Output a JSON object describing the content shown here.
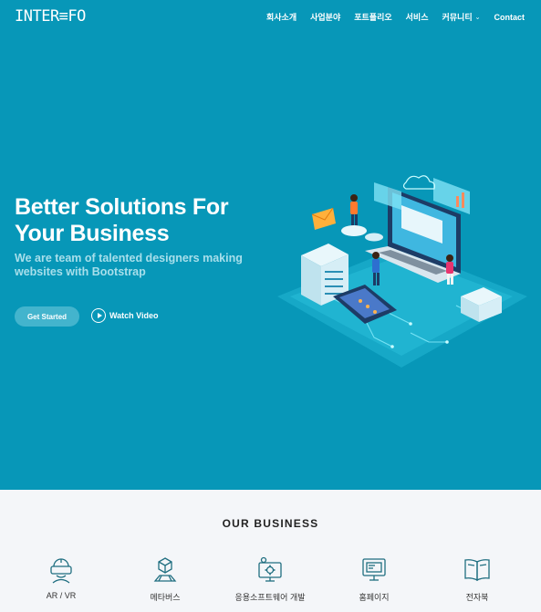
{
  "header": {
    "logo": "INTER≡FO",
    "nav": [
      {
        "label": "회사소개",
        "dropdown": false
      },
      {
        "label": "사업분야",
        "dropdown": false
      },
      {
        "label": "포트폴리오",
        "dropdown": false
      },
      {
        "label": "서비스",
        "dropdown": false
      },
      {
        "label": "커뮤니티",
        "dropdown": true
      },
      {
        "label": "Contact",
        "dropdown": false
      }
    ]
  },
  "hero": {
    "title_line1": "Better Solutions For",
    "title_line2": "Your Business",
    "subtitle_line1": "We are team of talented designers making",
    "subtitle_line2": "websites with Bootstrap",
    "cta_label": "Get Started",
    "video_label": "Watch Video"
  },
  "business": {
    "title": "OUR BUSINESS",
    "items": [
      {
        "label": "AR / VR",
        "icon": "vr-headset-icon"
      },
      {
        "label": "메타버스",
        "icon": "metaverse-cube-icon"
      },
      {
        "label": "응용소프트웨어 개발",
        "icon": "software-gear-icon"
      },
      {
        "label": "홈페이지",
        "icon": "monitor-web-icon"
      },
      {
        "label": "전자북",
        "icon": "ebook-icon"
      }
    ]
  },
  "colors": {
    "hero_bg": "#0797b8",
    "button_bg": "#43b4cd",
    "subtitle": "#a8dfeb",
    "icon_stroke": "#1f6e80"
  }
}
